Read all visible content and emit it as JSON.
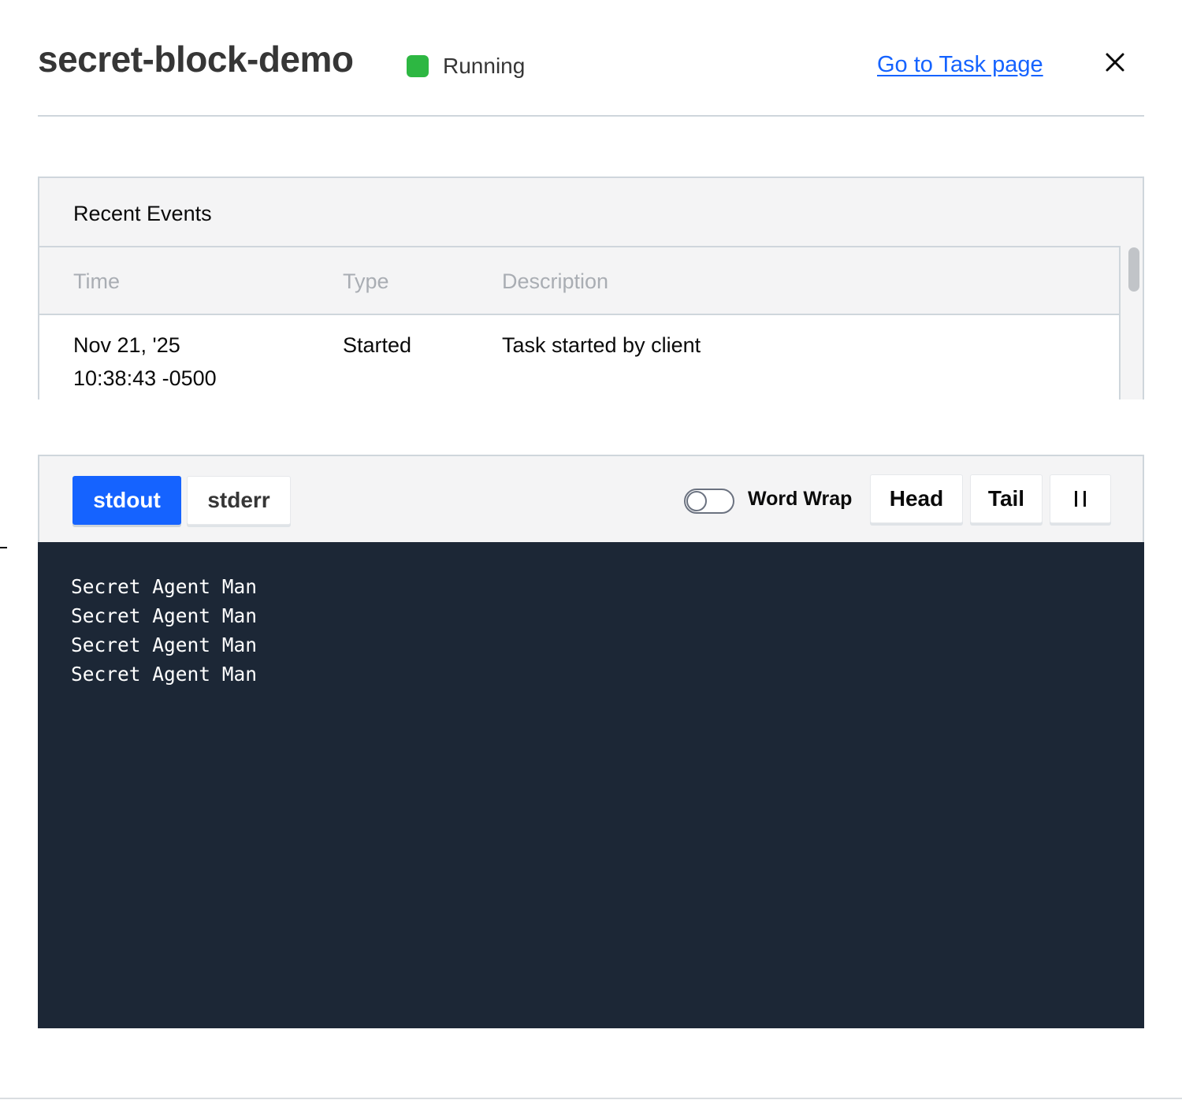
{
  "header": {
    "title": "secret-block-demo",
    "status_label": "Running",
    "status_color": "#2db742",
    "task_link_label": "Go to Task page",
    "close_icon": "close-icon"
  },
  "recent_events": {
    "title": "Recent Events",
    "columns": [
      "Time",
      "Type",
      "Description"
    ],
    "rows": [
      {
        "time_date": "Nov 21, '25",
        "time_clock": "10:38:43 -0500",
        "type": "Started",
        "description": "Task started by client"
      }
    ]
  },
  "log_viewer": {
    "tabs": [
      {
        "label": "stdout",
        "active": true
      },
      {
        "label": "stderr",
        "active": false
      }
    ],
    "word_wrap_label": "Word Wrap",
    "word_wrap_enabled": false,
    "head_label": "Head",
    "tail_label": "Tail",
    "pause_icon": "pause-icon",
    "lines": [
      "Secret Agent Man",
      "Secret Agent Man",
      "Secret Agent Man",
      "Secret Agent Man"
    ]
  },
  "colors": {
    "accent": "#1563ff",
    "log_background": "#1c2736"
  }
}
